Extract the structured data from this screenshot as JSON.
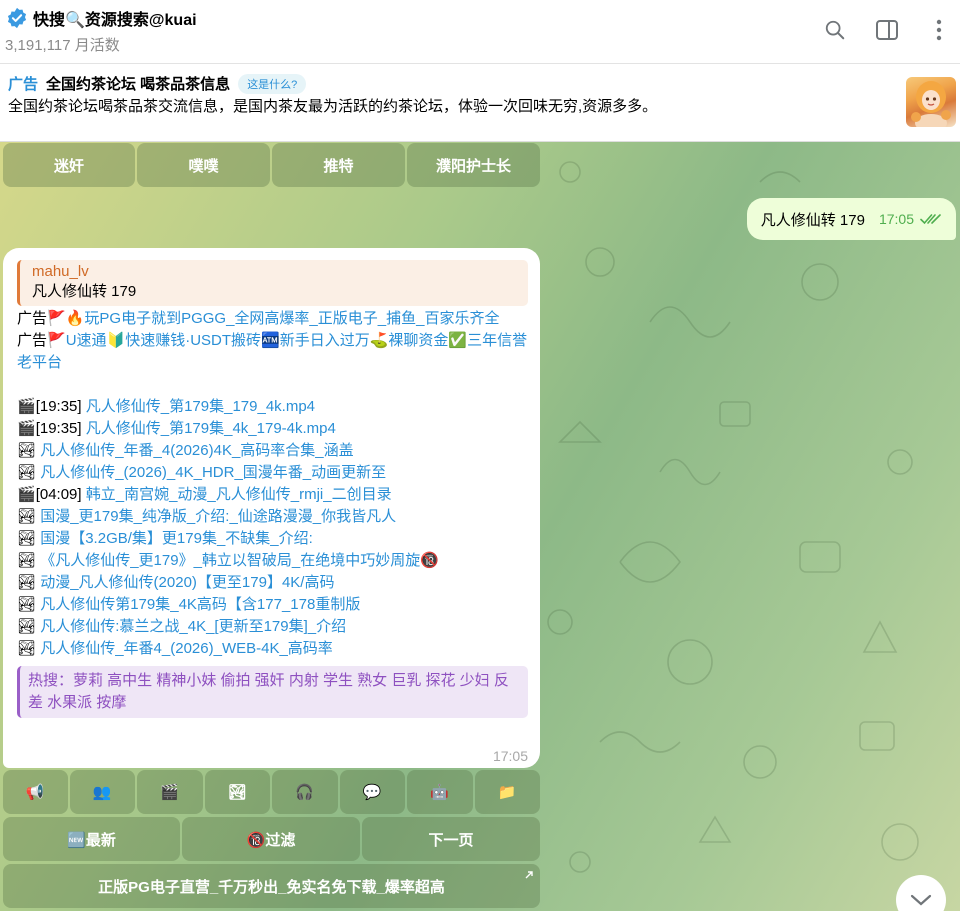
{
  "header": {
    "title": "快搜🔍资源搜索@kuai",
    "subtitle": "3,191,117 月活数",
    "icons": [
      "search-icon",
      "sidebar-toggle-icon",
      "more-vertical-icon"
    ]
  },
  "ad": {
    "label": "广告",
    "title": "全国约茶论坛 喝茶品茶信息",
    "pill": "这是什么?",
    "text": "全国约茶论坛喝茶品茶交流信息，是国内茶友最为活跃的约茶论坛，体验一次回味无穷,资源多多。"
  },
  "top_keyboard": [
    "迷奸",
    "噗噗",
    "推特",
    "濮阳护士长"
  ],
  "outgoing": {
    "text": "凡人修仙转 179",
    "time": "17:05"
  },
  "incoming": {
    "quote_name": "mahu_lv",
    "quote_text": "凡人修仙转 179",
    "ad1_prefix": "广告",
    "ad1_text": "玩PG电子就到PGGG_全网高爆率_正版电子_捕鱼_百家乐齐全",
    "ad2_prefix": "广告",
    "ad2_text": "U速通🔰快速赚钱·USDT搬砖🏧新手日入过万⛳裸聊资金✅三年信誉老平台",
    "results": [
      {
        "icon": "🎬",
        "pre": "[19:35] ",
        "text": "凡人修仙传_第179集_179_4k.mp4"
      },
      {
        "icon": "🎬",
        "pre": "[19:35] ",
        "text": "凡人修仙传_第179集_4k_179-4k.mp4"
      },
      {
        "icon": "🏞",
        "pre": "",
        "text": "凡人修仙传_年番_4(2026)4K_高码率合集_涵盖"
      },
      {
        "icon": "🏞",
        "pre": "",
        "text": "凡人修仙传_(2026)_4K_HDR_国漫年番_动画更新至"
      },
      {
        "icon": "🎬",
        "pre": "[04:09] ",
        "text": "韩立_南宫婉_动漫_凡人修仙传_rmji_二创目录"
      },
      {
        "icon": "🏞",
        "pre": "",
        "text": "国漫_更179集_纯净版_介绍:_仙途路漫漫_你我皆凡人"
      },
      {
        "icon": "🏞",
        "pre": "",
        "text": "国漫【3.2GB/集】更179集_不缺集_介绍:"
      },
      {
        "icon": "🏞",
        "pre": "",
        "text": "《凡人修仙传_更179》_韩立以智破局_在绝境中巧妙周旋🔞"
      },
      {
        "icon": "🏞",
        "pre": "",
        "text": "动漫_凡人修仙传(2020)【更至179】4K/高码"
      },
      {
        "icon": "🏞",
        "pre": "",
        "text": "凡人修仙传第179集_4K高码【含177_178重制版"
      },
      {
        "icon": "🏞",
        "pre": "",
        "text": "凡人修仙传:慕兰之战_4K_[更新至179集]_介绍"
      },
      {
        "icon": "🏞",
        "pre": "",
        "text": "凡人修仙传_年番4_(2026)_WEB-4K_高码率"
      }
    ],
    "hot": "热搜：萝莉 高中生 精神小妹 偷拍 强奸 内射 学生 熟女 巨乳 探花 少妇 反差 水果派 按摩",
    "time": "17:05"
  },
  "icon_keyboard": [
    "📢",
    "👥",
    "🎬",
    "🏞",
    "🎧",
    "💬",
    "🤖",
    "📁"
  ],
  "nav_keyboard": [
    "🆕最新",
    "🔞过滤",
    "下一页"
  ],
  "bottom_button": "正版PG电子直营_千万秒出_免实名免下载_爆率超高"
}
